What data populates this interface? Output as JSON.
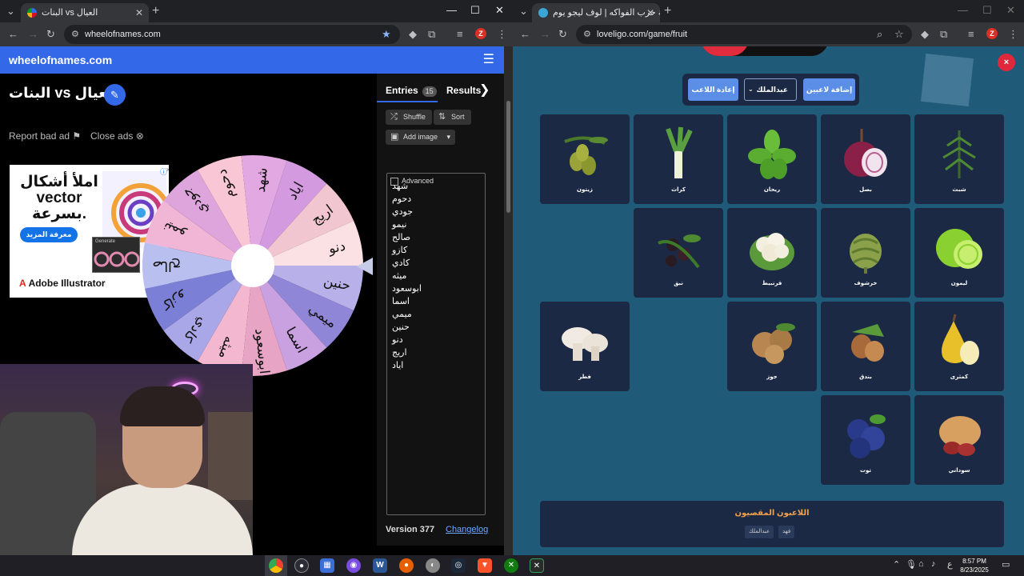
{
  "left_window": {
    "tab_title": "البنات vs العيال",
    "url": "wheelofnames.com",
    "new_tab": "+",
    "win_controls": {
      "minimize": "—",
      "maximize": "☐",
      "close": "✕"
    }
  },
  "right_window": {
    "tab_title": "لعبة حرب الفواكه | لوف ليجو يوم",
    "url": "loveligo.com/game/fruit",
    "new_tab": "+",
    "win_controls": {
      "minimize": "—",
      "maximize": "☐",
      "close": "✕"
    }
  },
  "wheel_site": {
    "logo": "wheelofnames.com",
    "wheel_title": "البنات vs العيال",
    "report_bad_ad": "Report bad ad",
    "close_ads": "Close ads",
    "ad": {
      "headline": "املأ أشكال vector بسرعة.",
      "cta": "معرفة المزيد",
      "brand_prefix": "Adobe",
      "brand_name": "Illustrator",
      "mini_window": "Generate"
    },
    "tabs": {
      "entries": "Entries",
      "entries_count": "15",
      "results": "Results"
    },
    "buttons": {
      "shuffle": "Shuffle",
      "sort": "Sort",
      "add_image": "Add image",
      "advanced": "Advanced"
    },
    "entries": [
      "شهد",
      "دحوم",
      "جودي",
      "نيمو",
      "صالح",
      "كازو",
      "كادي",
      "ميثه",
      "ابوسعود",
      "اسما",
      "ميمي",
      "حنين",
      "دنو",
      "اريج",
      "اياد"
    ],
    "wheel_labels": [
      "اياد",
      "اريج",
      "دنو",
      "حنين",
      "ميمي",
      "اسما",
      "ابوسعود",
      "ميثه",
      "كادي",
      "كازو",
      "صالح",
      "نيمو",
      "جودي",
      "دحوم",
      "شهد"
    ],
    "wheel_colors": [
      "#d39ae0",
      "#f2c6d0",
      "#fbe0e4",
      "#b8b0e8",
      "#8f86d8",
      "#c9a0e0",
      "#e8a4c4",
      "#f3b8cf",
      "#a9a7e8",
      "#7c7fd6",
      "#b9c0f0",
      "#f1b5d6",
      "#dea5dd",
      "#f9c6d5",
      "#e2a8e2"
    ],
    "version": "Version 377",
    "changelog": "Changelog"
  },
  "game": {
    "buttons": {
      "add_players": "إضافة لاعبين",
      "player_select": "عبدالملك",
      "reset_player": "إعادة اللاعب"
    },
    "cards": [
      {
        "label": "زيتون",
        "icon": "olive-icon"
      },
      {
        "label": "كراث",
        "icon": "leek-icon"
      },
      {
        "label": "ريحان",
        "icon": "basil-icon"
      },
      {
        "label": "بصل",
        "icon": "onion-icon"
      },
      {
        "label": "شبث",
        "icon": "dill-icon"
      },
      {
        "label": "نبق",
        "icon": "jujube-icon"
      },
      {
        "label": "قرنبيط",
        "icon": "cauliflower-icon"
      },
      {
        "label": "خرشوف",
        "icon": "artichoke-icon"
      },
      {
        "label": "ليمون",
        "icon": "lime-icon"
      },
      {
        "label": "فطر",
        "icon": "mushroom-icon"
      },
      {
        "label": "جوز",
        "icon": "walnut-icon"
      },
      {
        "label": "بندق",
        "icon": "hazelnut-icon"
      },
      {
        "label": "كمثرى",
        "icon": "pear-icon"
      },
      {
        "label": "توت",
        "icon": "blueberry-icon"
      },
      {
        "label": "سوداني",
        "icon": "peanut-icon"
      }
    ],
    "eliminated_title": "اللاعبون المقصيون",
    "eliminated_players": [
      "عبدالملك",
      "فهد"
    ],
    "close_button": "×"
  },
  "taskbar": {
    "clock_time": "8:57 PM",
    "clock_date": "8/23/2025",
    "lang": "ع"
  }
}
